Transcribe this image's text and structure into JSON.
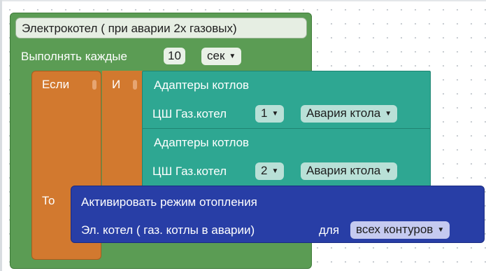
{
  "event": {
    "title": "Электрокотел ( при аварии 2х газовых)",
    "repeat_label": "Выполнять каждые",
    "repeat_value": "10",
    "repeat_unit": "сек"
  },
  "if_block": {
    "if_label": "Если",
    "and_label": "И",
    "then_label": "То"
  },
  "conditions": [
    {
      "title": "Адаптеры котлов",
      "device_label": "ЦШ Газ.котел",
      "device_number": "1",
      "state": "Авария ктола"
    },
    {
      "title": "Адаптеры котлов",
      "device_label": "ЦШ Газ.котел",
      "device_number": "2",
      "state": "Авария ктола"
    }
  ],
  "action": {
    "title": "Активировать режим отопления",
    "target_label": "Эл. котел ( газ. котлы в аварии)",
    "for_label": "для",
    "scope": "всех контуров"
  },
  "dropdown_arrow": "▼",
  "colors": {
    "event_green": "#5b9c54",
    "logic_orange": "#d2792f",
    "adapter_teal": "#2ea792",
    "action_blue": "#283ea6"
  }
}
